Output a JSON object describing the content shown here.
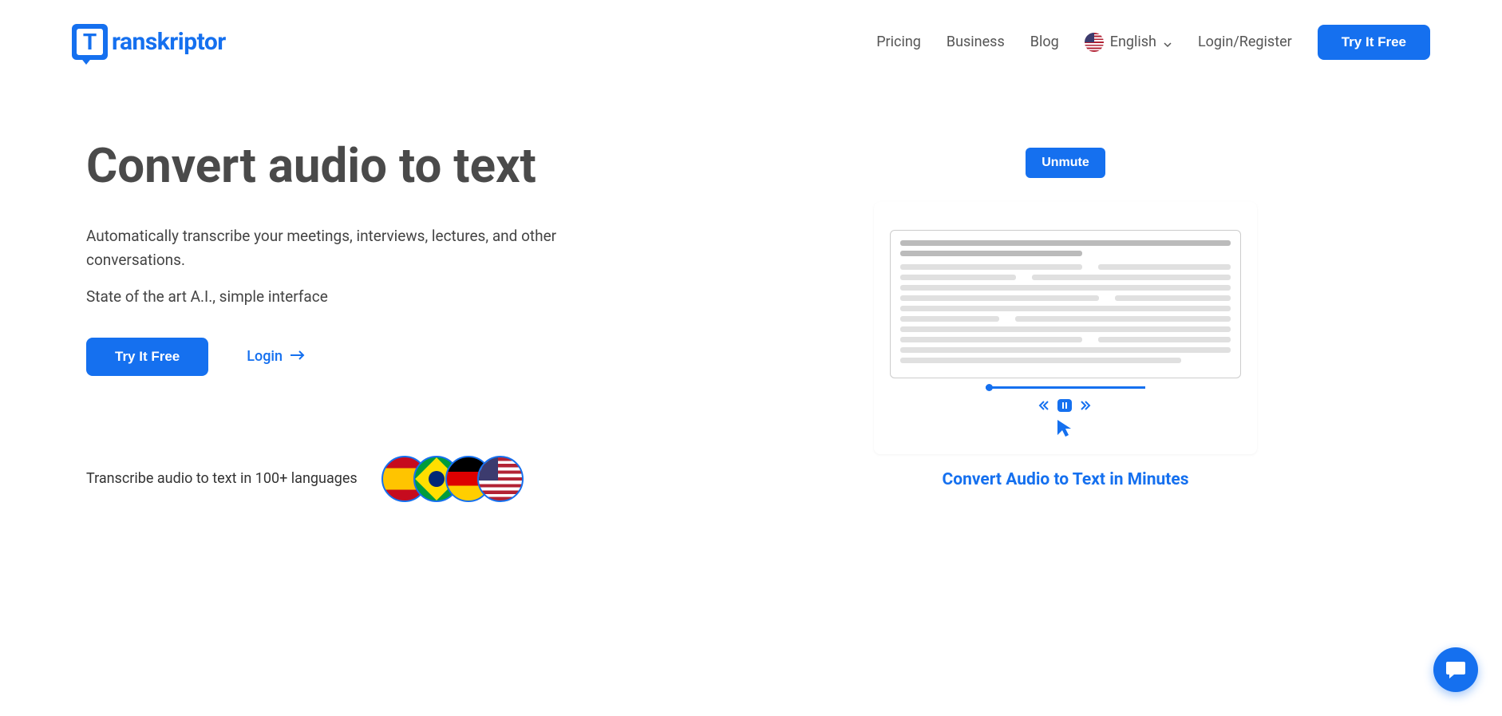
{
  "brand": {
    "name": "ranskriptor"
  },
  "nav": {
    "pricing": "Pricing",
    "business": "Business",
    "blog": "Blog",
    "language": "English",
    "login_register": "Login/Register",
    "try_free": "Try It Free"
  },
  "hero": {
    "title": "Convert audio to text",
    "description": "Automatically transcribe your meetings, interviews, lectures, and other conversations.",
    "subtext": "State of the art A.I., simple interface",
    "cta_primary": "Try It Free",
    "cta_secondary": "Login",
    "languages_text": "Transcribe audio to text in 100+ languages"
  },
  "video": {
    "unmute": "Unmute",
    "caption": "Convert Audio to Text in Minutes"
  },
  "flags": [
    "spain",
    "brazil",
    "germany",
    "usa"
  ]
}
